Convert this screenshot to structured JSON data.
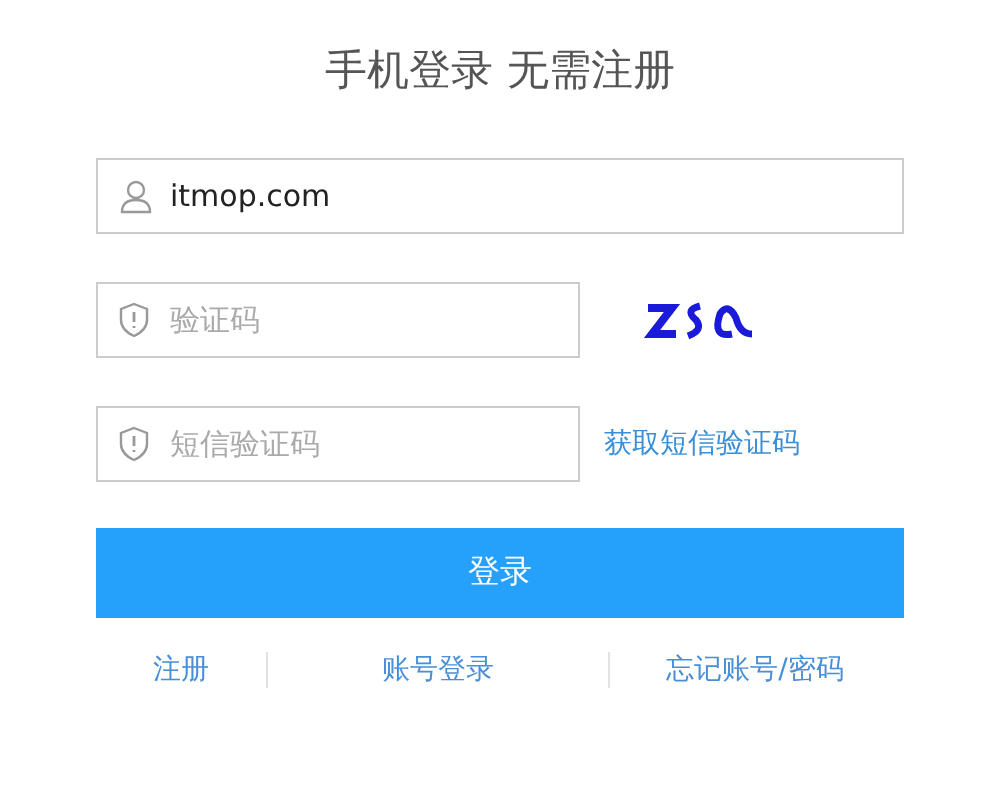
{
  "title": "手机登录 无需注册",
  "fields": [
    {
      "kind": "account",
      "value": "itmop.com"
    },
    {
      "kind": "captcha",
      "placeholder": "验证码"
    },
    {
      "kind": "sms",
      "placeholder": "短信验证码",
      "link": "获取短信验证码"
    }
  ],
  "submit": "登录",
  "links": [
    "注册",
    "账号登录",
    "忘记账号/密码"
  ]
}
